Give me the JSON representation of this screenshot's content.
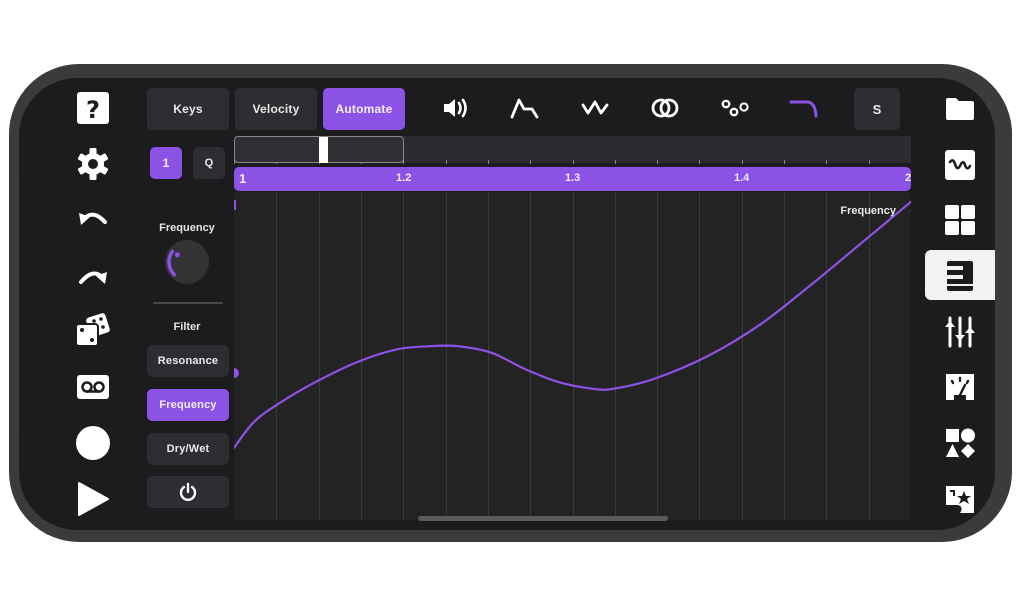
{
  "left_toolbar": {
    "items": [
      {
        "name": "help",
        "icon": "question-mark-icon"
      },
      {
        "name": "settings",
        "icon": "gear-icon"
      },
      {
        "name": "undo",
        "icon": "undo-icon"
      },
      {
        "name": "redo",
        "icon": "redo-icon"
      },
      {
        "name": "randomize",
        "icon": "dice-icon"
      },
      {
        "name": "loop",
        "icon": "cassette-icon"
      },
      {
        "name": "record",
        "icon": "record-icon"
      },
      {
        "name": "play",
        "icon": "play-icon"
      }
    ]
  },
  "mode_tabs": [
    {
      "label": "Keys",
      "active": false
    },
    {
      "label": "Velocity",
      "active": false
    },
    {
      "label": "Automate",
      "active": true
    }
  ],
  "top_toolbar": {
    "icons": [
      {
        "name": "volume-icon",
        "active": false
      },
      {
        "name": "envelope-icon",
        "active": false
      },
      {
        "name": "lfo-wave-icon",
        "active": false
      },
      {
        "name": "chorus-rings-icon",
        "active": false
      },
      {
        "name": "delay-dots-icon",
        "active": false
      },
      {
        "name": "filter-curve-icon",
        "active": true
      }
    ],
    "s_button": "S"
  },
  "track_controls": {
    "track_button": "1",
    "quantize_button": "Q"
  },
  "knob": {
    "label": "Frequency",
    "value_fraction": 0.3
  },
  "param_panel": {
    "section_label": "Filter",
    "buttons": [
      {
        "label": "Resonance",
        "active": false
      },
      {
        "label": "Frequency",
        "active": true
      },
      {
        "label": "Dry/Wet",
        "active": false
      }
    ],
    "power_icon": "power-icon"
  },
  "timeline": {
    "ruler_labels": [
      "1",
      "1.2",
      "1.3",
      "1.4",
      "2"
    ],
    "playhead_position_bars": 1.05,
    "view_window": "1 – 1.2"
  },
  "automation": {
    "lane_label": "Frequency",
    "accent_color": "#8c52e6",
    "curve_points": [
      [
        0.0,
        0.22
      ],
      [
        0.03,
        0.3
      ],
      [
        0.07,
        0.36
      ],
      [
        0.12,
        0.42
      ],
      [
        0.18,
        0.48
      ],
      [
        0.24,
        0.52
      ],
      [
        0.29,
        0.53
      ],
      [
        0.33,
        0.53
      ],
      [
        0.38,
        0.51
      ],
      [
        0.43,
        0.46
      ],
      [
        0.48,
        0.42
      ],
      [
        0.53,
        0.4
      ],
      [
        0.56,
        0.4
      ],
      [
        0.62,
        0.43
      ],
      [
        0.7,
        0.5
      ],
      [
        0.78,
        0.6
      ],
      [
        0.86,
        0.73
      ],
      [
        0.93,
        0.85
      ],
      [
        1.0,
        0.97
      ]
    ]
  },
  "right_toolbar": {
    "items": [
      {
        "name": "files",
        "icon": "folder-icon",
        "active": false
      },
      {
        "name": "synth",
        "icon": "waveform-icon",
        "active": false
      },
      {
        "name": "pads",
        "icon": "grid-icon",
        "active": false
      },
      {
        "name": "piano-roll",
        "icon": "piano-keys-icon",
        "active": true
      },
      {
        "name": "mixer",
        "icon": "sliders-icon",
        "active": false
      },
      {
        "name": "meter",
        "icon": "gauge-icon",
        "active": false
      },
      {
        "name": "sounds",
        "icon": "shapes-icon",
        "active": false
      },
      {
        "name": "favorites",
        "icon": "star-map-icon",
        "active": false
      }
    ]
  }
}
